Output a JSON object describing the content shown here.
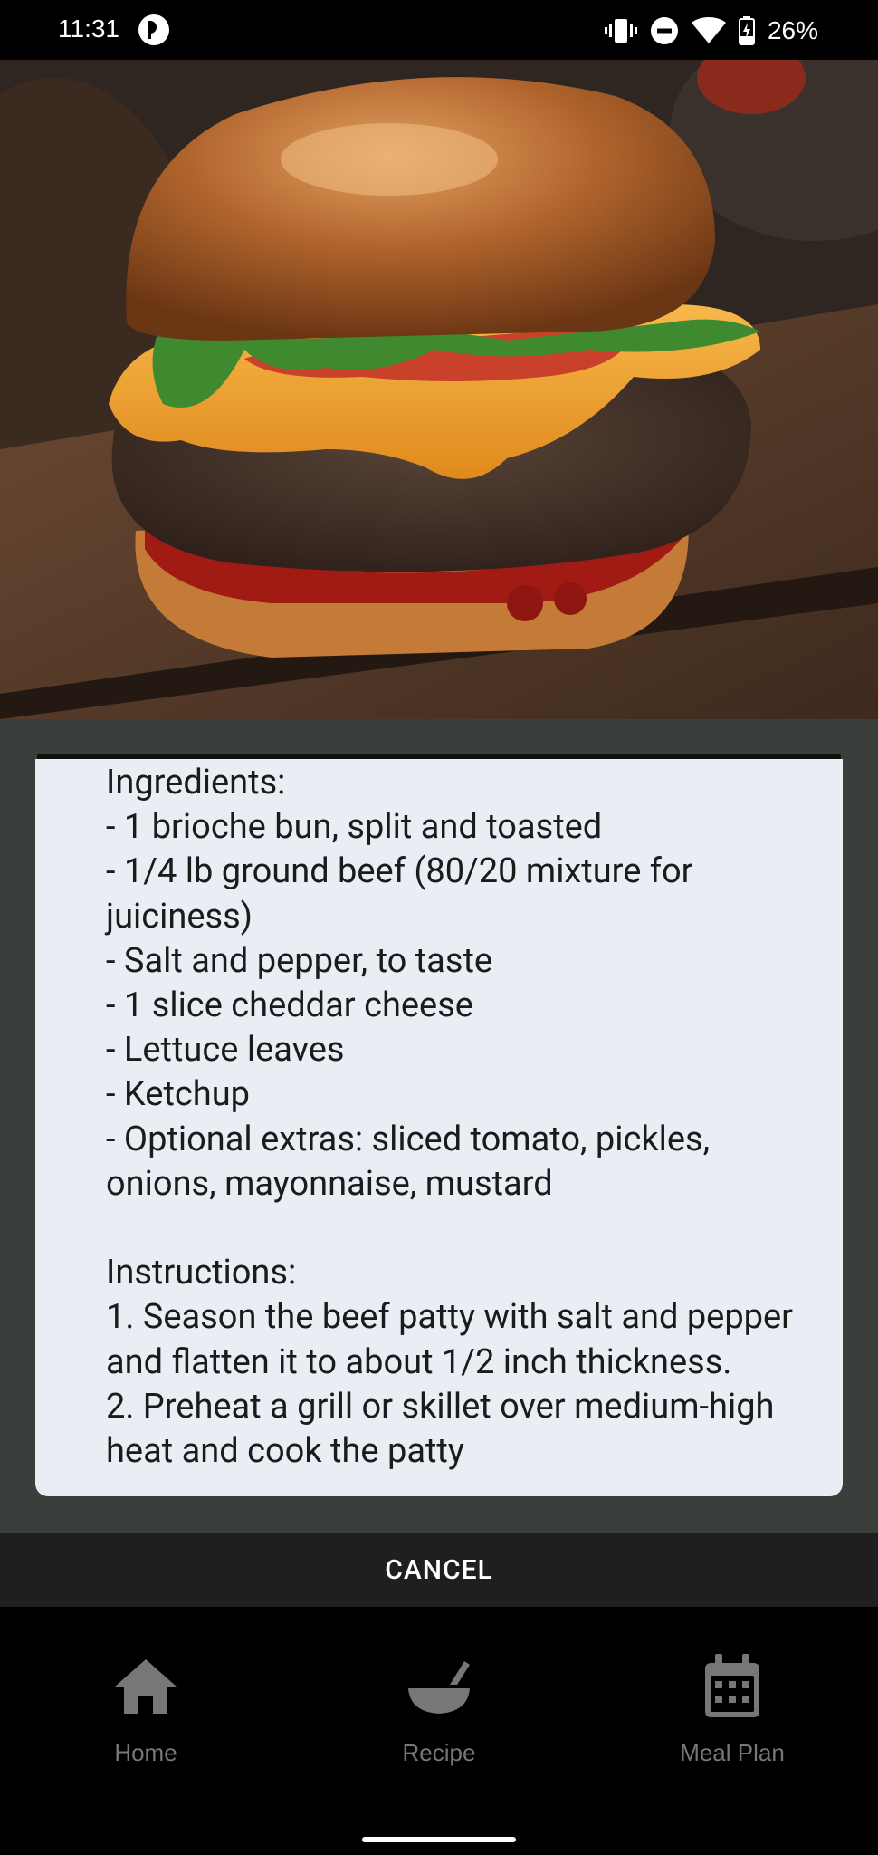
{
  "status_bar": {
    "time": "11:31",
    "battery": "26%",
    "icons": [
      "app-notification-icon",
      "vibrate-icon",
      "do-not-disturb-icon",
      "wifi-icon",
      "battery-charging-icon"
    ]
  },
  "hero": {
    "image_description_icon": "burger-photo"
  },
  "recipe": {
    "text": "Ingredients:\n- 1 brioche bun, split and toasted\n- 1/4 lb ground beef (80/20 mixture for juiciness)\n- Salt and pepper, to taste\n- 1 slice cheddar cheese\n- Lettuce leaves\n- Ketchup\n- Optional extras: sliced tomato, pickles, onions, mayonnaise, mustard\n\nInstructions:\n1. Season the beef patty with salt and pepper and flatten it to about 1/2 inch thickness.\n2. Preheat a grill or skillet over medium-high heat and cook the patty"
  },
  "dialog": {
    "cancel_label": "CANCEL"
  },
  "bottom_nav": {
    "items": [
      {
        "label": "Home",
        "icon": "home-icon"
      },
      {
        "label": "Recipe",
        "icon": "bowl-icon"
      },
      {
        "label": "Meal Plan",
        "icon": "calendar-icon"
      }
    ]
  },
  "colors": {
    "backdrop": "#3a3f3b",
    "card": "#e8eef3",
    "nav_icon": "#777777"
  }
}
